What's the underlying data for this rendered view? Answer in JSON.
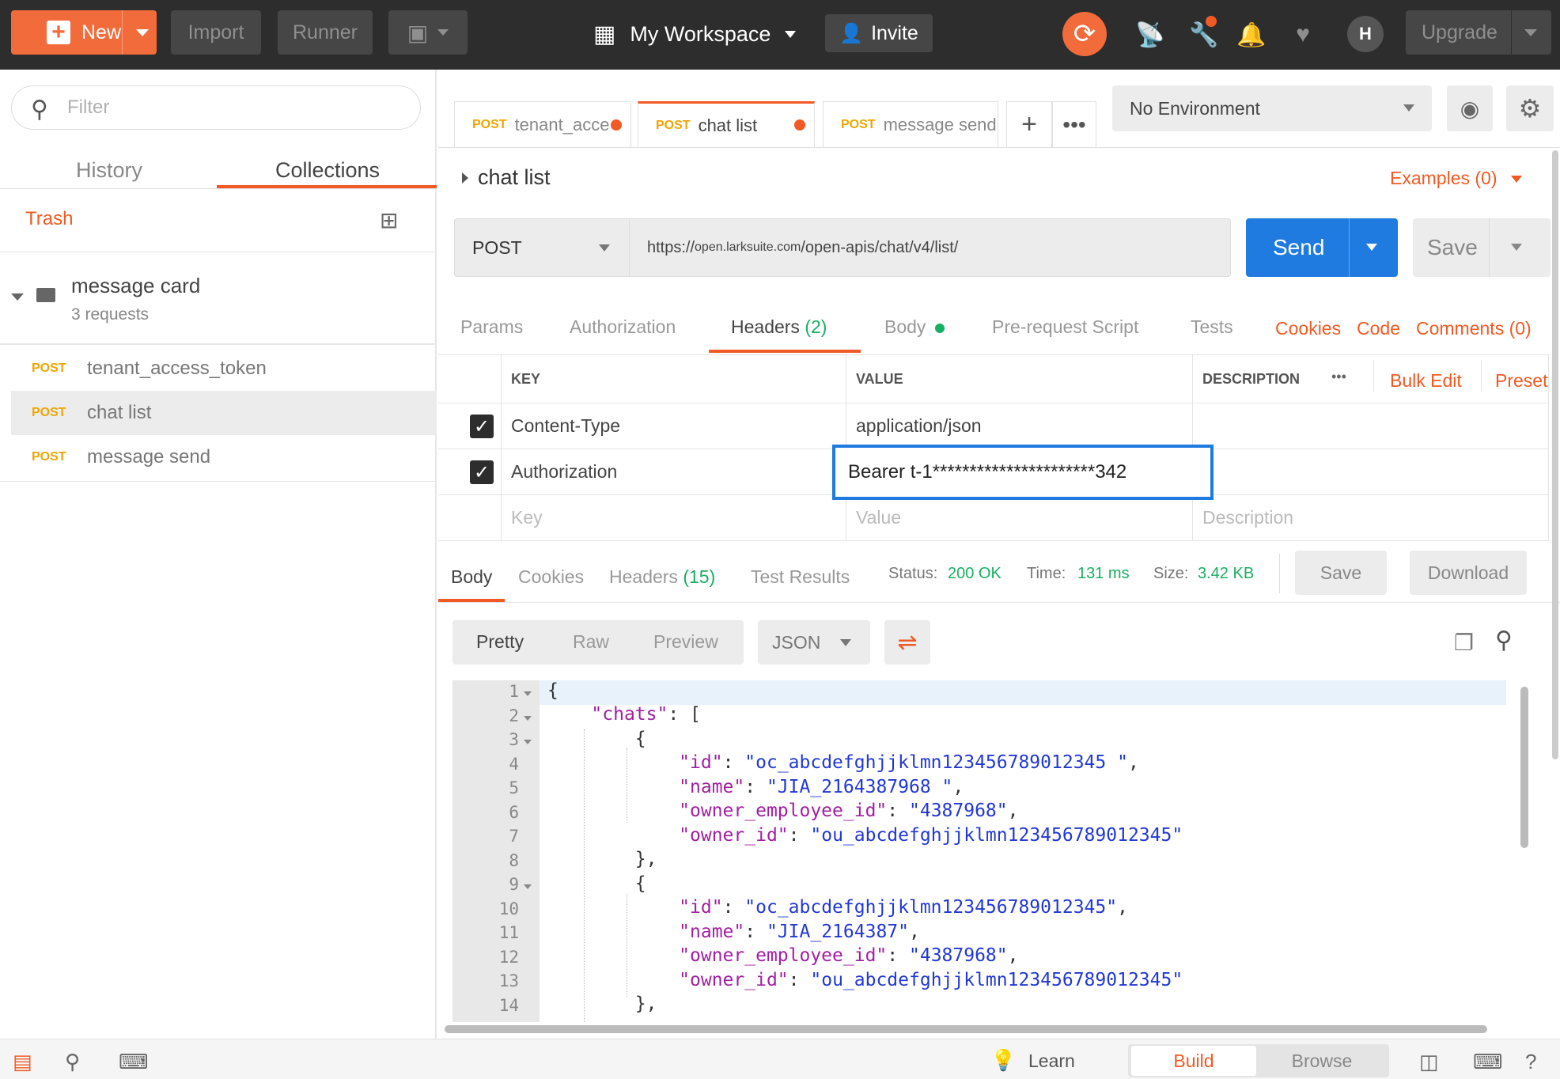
{
  "topbar": {
    "new_label": "New",
    "import_label": "Import",
    "runner_label": "Runner",
    "workspace_label": "My Workspace",
    "invite_label": "Invite",
    "upgrade_label": "Upgrade",
    "avatar_initial": "H",
    "accent_color": "#f26b3a"
  },
  "sidebar": {
    "filter_placeholder": "Filter",
    "tabs": [
      "History",
      "Collections"
    ],
    "active_tab": "Collections",
    "trash_label": "Trash",
    "collection": {
      "name": "message card",
      "count": "3 requests"
    },
    "requests": [
      {
        "method": "POST",
        "name": "tenant_access_token"
      },
      {
        "method": "POST",
        "name": "chat list"
      },
      {
        "method": "POST",
        "name": "message send"
      }
    ]
  },
  "tabs": [
    {
      "method": "POST",
      "name": "tenant_acce"
    },
    {
      "method": "POST",
      "name": "chat list"
    },
    {
      "method": "POST",
      "name": "message send"
    }
  ],
  "environment": {
    "selected": "No Environment"
  },
  "request": {
    "title": "chat list",
    "examples_label": "Examples (0)",
    "method": "POST",
    "url_prefix": "https://",
    "url_host": "open.larksuite.com",
    "url_path": "/open-apis/chat/v4/list/",
    "send_label": "Send",
    "save_label": "Save",
    "subtabs": [
      "Params",
      "Authorization",
      "Headers",
      "Body",
      "Pre-request Script",
      "Tests"
    ],
    "headers_count": "(2)",
    "links": [
      "Cookies",
      "Code",
      "Comments (0)"
    ]
  },
  "headers_table": {
    "columns": [
      "KEY",
      "VALUE",
      "DESCRIPTION"
    ],
    "more_label": "•••",
    "bulk_edit_label": "Bulk Edit",
    "presets_label": "Preset",
    "rows": [
      {
        "key": "Content-Type",
        "value": "application/json"
      },
      {
        "key": "Authorization",
        "value": "Bearer t-1**********************342"
      }
    ],
    "placeholders": {
      "key": "Key",
      "value": "Value",
      "description": "Description"
    }
  },
  "response": {
    "tabs": [
      "Body",
      "Cookies",
      "Headers",
      "Test Results"
    ],
    "headers_count": "(15)",
    "status_label": "Status:",
    "status_value": "200 OK",
    "time_label": "Time:",
    "time_value": "131 ms",
    "size_label": "Size:",
    "size_value": "3.42 KB",
    "save_label": "Save",
    "download_label": "Download",
    "view_modes": [
      "Pretty",
      "Raw",
      "Preview"
    ],
    "format": "JSON",
    "code_lines": [
      {
        "n": "1",
        "fold": true
      },
      {
        "n": "2",
        "fold": true
      },
      {
        "n": "3",
        "fold": true
      },
      {
        "n": "4",
        "fold": false
      },
      {
        "n": "5",
        "fold": false
      },
      {
        "n": "6",
        "fold": false
      },
      {
        "n": "7",
        "fold": false
      },
      {
        "n": "8",
        "fold": false
      },
      {
        "n": "9",
        "fold": true
      },
      {
        "n": "10",
        "fold": false
      },
      {
        "n": "11",
        "fold": false
      },
      {
        "n": "12",
        "fold": false
      },
      {
        "n": "13",
        "fold": false
      },
      {
        "n": "14",
        "fold": false
      }
    ],
    "json": {
      "root_key": "chats",
      "chats": [
        {
          "id": "oc_abcdefghjjklmn123456789012345 ",
          "name": "JIA_2164387968 ",
          "owner_employee_id": "4387968",
          "owner_id": "ou_abcdefghjjklmn123456789012345"
        },
        {
          "id": "oc_abcdefghjjklmn123456789012345",
          "name": "JIA_2164387",
          "owner_employee_id": "4387968",
          "owner_id": "ou_abcdefghjjklmn123456789012345"
        }
      ]
    }
  },
  "footer": {
    "learn_label": "Learn",
    "build_label": "Build",
    "browse_label": "Browse"
  }
}
